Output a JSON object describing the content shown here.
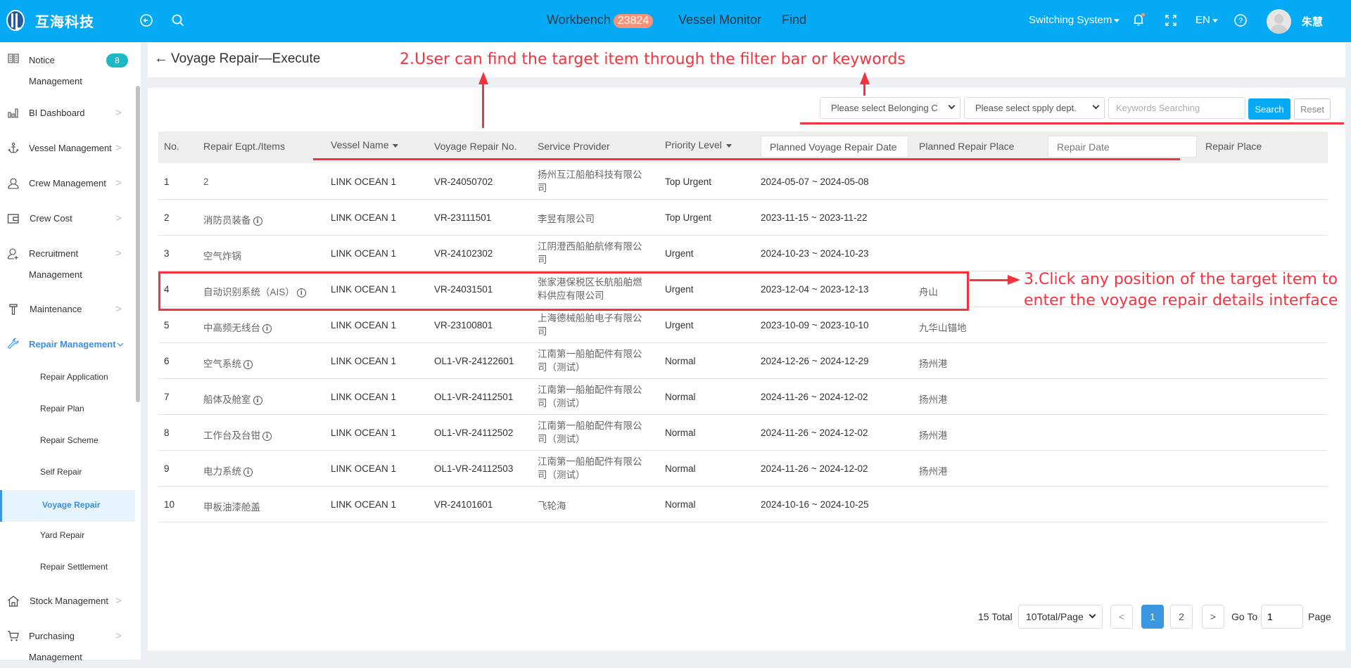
{
  "topbar": {
    "brand": "互海科技",
    "nav": [
      {
        "label": "Workbench",
        "badge": "23824"
      },
      {
        "label": "Vessel Monitor"
      },
      {
        "label": "Find"
      }
    ],
    "switching_system": "Switching System",
    "language": "EN",
    "username": "朱慧",
    "icons": [
      "back-circle-icon",
      "search-icon",
      "bell-icon",
      "fullscreen-icon",
      "help-icon"
    ],
    "colors": {
      "bar": "#06a9f4",
      "badge": "#f99378",
      "notification_dot": "#f99378"
    }
  },
  "sidebar": {
    "items": [
      {
        "label": "Notice",
        "label2": "Management",
        "icon": "notice-book-icon",
        "badge": "8"
      },
      {
        "label": "BI Dashboard",
        "icon": "bar-chart-icon"
      },
      {
        "label": "Vessel Management",
        "icon": "anchor-icon"
      },
      {
        "label": "Crew Management",
        "icon": "person-icon"
      },
      {
        "label": "Crew Cost",
        "icon": "wallet-icon"
      },
      {
        "label": "Recruitment",
        "label2": "Management",
        "icon": "person-add-icon"
      },
      {
        "label": "Maintenance",
        "icon": "hammer-icon"
      },
      {
        "label": "Repair Management",
        "icon": "wrench-icon",
        "expanded": true
      },
      {
        "label": "Stock Management",
        "icon": "house-icon"
      },
      {
        "label": "Purchasing",
        "label2": "Management",
        "icon": "cart-icon"
      }
    ],
    "sub_items": [
      {
        "label": "Repair Application"
      },
      {
        "label": "Repair Plan"
      },
      {
        "label": "Repair Scheme"
      },
      {
        "label": "Self Repair"
      },
      {
        "label": "Voyage Repair",
        "active": true
      },
      {
        "label": "Yard Repair"
      },
      {
        "label": "Repair Settlement"
      }
    ],
    "active_color": "#3a8ee6"
  },
  "page": {
    "title": "Voyage Repair—Execute"
  },
  "filters": {
    "belonging_select": "Please select Belonging C",
    "dept_select": "Please select spply dept.",
    "keywords_placeholder": "Keywords Searching",
    "search_label": "Search",
    "reset_label": "Reset"
  },
  "table": {
    "headers": {
      "no": "No.",
      "items": "Repair Eqpt./Items",
      "vessel": "Vessel Name",
      "vr_no": "Voyage Repair No.",
      "provider": "Service Provider",
      "priority": "Priority Level",
      "planned_date": "Planned Voyage Repair Date",
      "planned_place": "Planned Repair Place",
      "repair_date": "Repair Date",
      "repair_place": "Repair Place"
    },
    "rows": [
      {
        "no": "1",
        "item": "2",
        "info": false,
        "vessel": "LINK OCEAN 1",
        "vr_no": "VR-24050702",
        "provider": "扬州互江船舶科技有限公司",
        "priority": "Top Urgent",
        "planned_date": "2024-05-07  ~  2024-05-08",
        "planned_place": "",
        "repair_date": "",
        "repair_place": ""
      },
      {
        "no": "2",
        "item": "消防员装备",
        "info": true,
        "vessel": "LINK OCEAN 1",
        "vr_no": "VR-23111501",
        "provider": "李昱有限公司",
        "priority": "Top Urgent",
        "planned_date": "2023-11-15  ~  2023-11-22",
        "planned_place": "",
        "repair_date": "",
        "repair_place": ""
      },
      {
        "no": "3",
        "item": "空气炸锅",
        "info": false,
        "vessel": "LINK OCEAN 1",
        "vr_no": "VR-24102302",
        "provider": "江阴澄西船舶航修有限公司",
        "priority": "Urgent",
        "planned_date": "2024-10-23  ~  2024-10-23",
        "planned_place": "",
        "repair_date": "",
        "repair_place": ""
      },
      {
        "no": "4",
        "item": "自动识别系统（AIS）",
        "info": true,
        "vessel": "LINK OCEAN 1",
        "vr_no": "VR-24031501",
        "provider": "张家港保税区长航船舶燃料供应有限公司",
        "priority": "Urgent",
        "planned_date": "2023-12-04  ~  2023-12-13",
        "planned_place": "舟山",
        "repair_date": "",
        "repair_place": ""
      },
      {
        "no": "5",
        "item": "中高频无线台",
        "info": true,
        "vessel": "LINK OCEAN 1",
        "vr_no": "VR-23100801",
        "provider": "上海德械船舶电子有限公司",
        "priority": "Urgent",
        "planned_date": "2023-10-09  ~  2023-10-10",
        "planned_place": "九华山锚地",
        "repair_date": "",
        "repair_place": ""
      },
      {
        "no": "6",
        "item": "空气系统",
        "info": true,
        "vessel": "LINK OCEAN 1",
        "vr_no": "OL1-VR-24122601",
        "provider": "江南第一船舶配件有限公司（测试）",
        "priority": "Normal",
        "planned_date": "2024-12-26  ~  2024-12-29",
        "planned_place": "扬州港",
        "repair_date": "",
        "repair_place": ""
      },
      {
        "no": "7",
        "item": "船体及舱室",
        "info": true,
        "vessel": "LINK OCEAN 1",
        "vr_no": "OL1-VR-24112501",
        "provider": "江南第一船舶配件有限公司（测试）",
        "priority": "Normal",
        "planned_date": "2024-11-26  ~  2024-12-02",
        "planned_place": "扬州港",
        "repair_date": "",
        "repair_place": ""
      },
      {
        "no": "8",
        "item": "工作台及台钳",
        "info": true,
        "vessel": "LINK OCEAN 1",
        "vr_no": "OL1-VR-24112502",
        "provider": "江南第一船舶配件有限公司（测试）",
        "priority": "Normal",
        "planned_date": "2024-11-26  ~  2024-12-02",
        "planned_place": "扬州港",
        "repair_date": "",
        "repair_place": ""
      },
      {
        "no": "9",
        "item": "电力系统",
        "info": true,
        "vessel": "LINK OCEAN 1",
        "vr_no": "OL1-VR-24112503",
        "provider": "江南第一船舶配件有限公司（测试）",
        "priority": "Normal",
        "planned_date": "2024-11-26  ~  2024-12-02",
        "planned_place": "扬州港",
        "repair_date": "",
        "repair_place": ""
      },
      {
        "no": "10",
        "item": "甲板油漆舱盖",
        "info": false,
        "vessel": "LINK OCEAN 1",
        "vr_no": "VR-24101601",
        "provider": "飞轮海",
        "priority": "Normal",
        "planned_date": "2024-10-16  ~  2024-10-25",
        "planned_place": "",
        "repair_date": "",
        "repair_place": ""
      }
    ]
  },
  "pagination": {
    "total": "15 Total",
    "page_size": "10Total/Page",
    "prev": "<",
    "pages": [
      "1",
      "2"
    ],
    "current": "1",
    "next": ">",
    "goto_label": "Go To",
    "goto_value": "1",
    "page_label": "Page"
  },
  "annotations": {
    "step2": "2.User can find the target item through the filter bar or keywords",
    "step3_line1": "3.Click any position of the target item to",
    "step3_line2": "enter the voyage repair details interface",
    "color": "#f5333f"
  }
}
